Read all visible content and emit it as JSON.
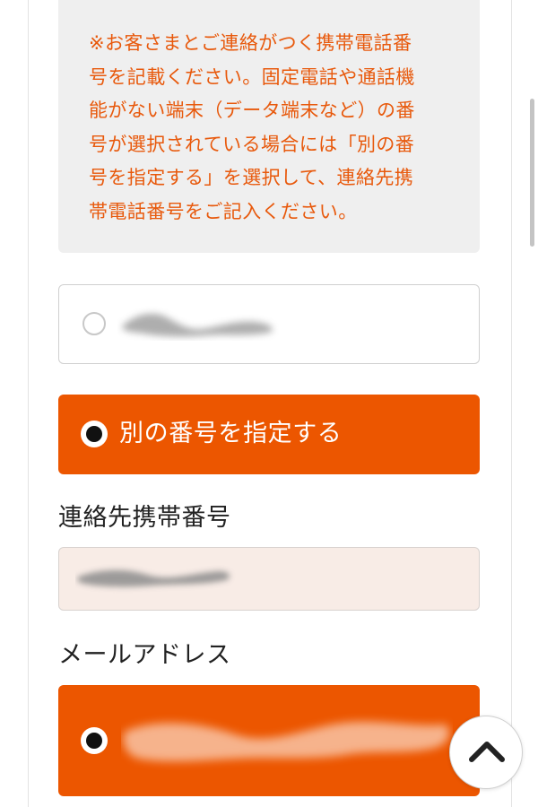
{
  "notice": {
    "text": "※お客さまとご連絡がつく携帯電話番\n号を記載ください。固定電話や通話機\n能がない端末（データ端末など）の番\n号が選択されている場合には「別の番\n号を指定する」を選択して、連絡先携\n帯電話番号をご記入ください。"
  },
  "options": {
    "registered_phone": {
      "selected": false
    },
    "other_number": {
      "label": "別の番号を指定する",
      "selected": true
    },
    "email": {
      "selected": true
    }
  },
  "contact": {
    "heading": "連絡先携帯番号"
  },
  "email": {
    "heading": "メールアドレス"
  },
  "icons": {
    "scroll_top": "chevron-up-icon"
  },
  "colors": {
    "accent": "#ec5600",
    "notice_text": "#e8590c",
    "notice_bg": "#efefef",
    "field_bg": "#f8ece6"
  }
}
